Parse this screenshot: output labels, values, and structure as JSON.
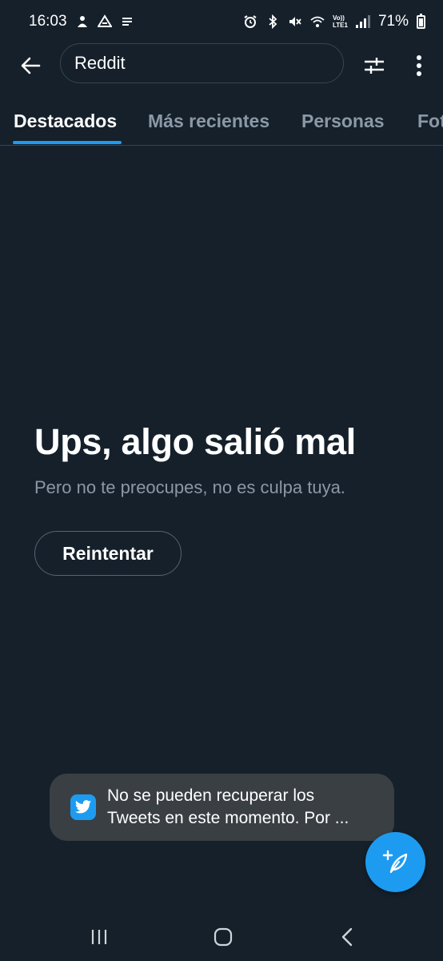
{
  "status_bar": {
    "time": "16:03",
    "battery": "71%",
    "battery_level": 0.71,
    "left_icons": [
      "notification-person-icon",
      "drive-icon",
      "app-icon"
    ],
    "right_icons": [
      "alarm-icon",
      "bluetooth-icon",
      "mute-icon",
      "wifi-icon",
      "volte-icon",
      "signal-icon",
      "battery-icon"
    ],
    "volte_label": "Vo))",
    "lte_label": "LTE1"
  },
  "top_bar": {
    "back_icon": "arrow-left-icon",
    "search_value": "Reddit",
    "filter_icon": "sliders-icon",
    "more_icon": "more-vertical-icon"
  },
  "tabs": [
    {
      "label": "Destacados",
      "active": true
    },
    {
      "label": "Más recientes",
      "active": false
    },
    {
      "label": "Personas",
      "active": false
    },
    {
      "label": "Fotos",
      "active": false
    }
  ],
  "error": {
    "title": "Ups, algo salió mal",
    "subtitle": "Pero no te preocupes, no es culpa tuya.",
    "retry_label": "Reintentar"
  },
  "toast": {
    "icon": "twitter-bird-icon",
    "line1": "No se pueden recuperar los",
    "line2": "Tweets en este momento. Por ..."
  },
  "fab": {
    "icon": "compose-tweet-icon"
  },
  "nav_bar": {
    "recents_icon": "recents-icon",
    "home_icon": "home-icon",
    "back_icon": "back-chevron-icon"
  },
  "colors": {
    "background": "#15202b",
    "accent": "#1d9bf0",
    "muted_text": "#8b98a5",
    "border": "#38444d",
    "toast_background": "#3a3f44"
  }
}
